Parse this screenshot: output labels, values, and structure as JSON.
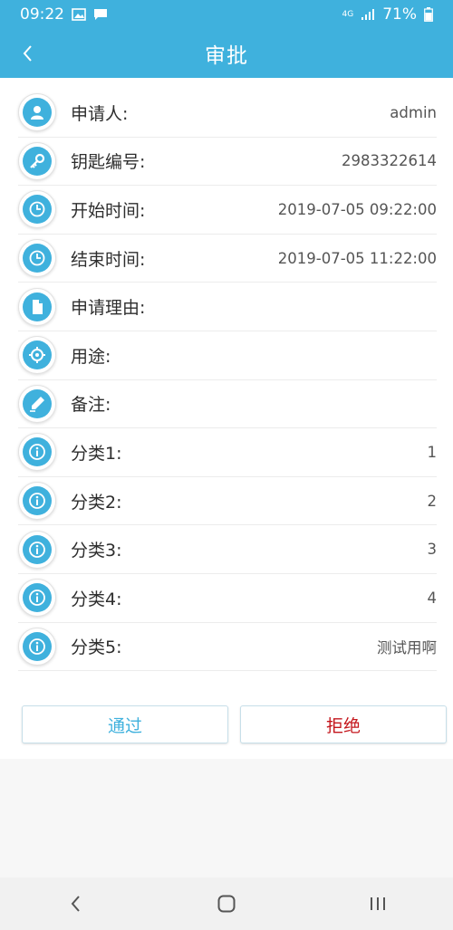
{
  "status_bar": {
    "time": "09:22",
    "network": "4G",
    "battery": "71%",
    "icons": [
      "gallery-icon",
      "message-icon",
      "signal-icon",
      "battery-icon"
    ]
  },
  "header": {
    "title": "审批",
    "back_icon": "chevron-left-icon"
  },
  "details": [
    {
      "icon": "user-icon",
      "label": "申请人:",
      "value": "admin"
    },
    {
      "icon": "key-icon",
      "label": "钥匙编号:",
      "value": "2983322614"
    },
    {
      "icon": "clock-icon",
      "label": "开始时间:",
      "value": "2019-07-05 09:22:00"
    },
    {
      "icon": "clock-icon",
      "label": "结束时间:",
      "value": "2019-07-05 11:22:00"
    },
    {
      "icon": "document-icon",
      "label": "申请理由:",
      "value": ""
    },
    {
      "icon": "target-icon",
      "label": "用途:",
      "value": ""
    },
    {
      "icon": "pen-icon",
      "label": "备注:",
      "value": ""
    },
    {
      "icon": "info-icon",
      "label": "分类1:",
      "value": "1"
    },
    {
      "icon": "info-icon",
      "label": "分类2:",
      "value": "2"
    },
    {
      "icon": "info-icon",
      "label": "分类3:",
      "value": "3"
    },
    {
      "icon": "info-icon",
      "label": "分类4:",
      "value": "4"
    },
    {
      "icon": "info-icon",
      "label": "分类5:",
      "value": "测试用啊"
    }
  ],
  "actions": {
    "approve_label": "通过",
    "reject_label": "拒绝"
  },
  "colors": {
    "primary": "#3fb1dd",
    "reject": "#c4161c"
  },
  "system_nav": {
    "back": "back-icon",
    "home": "home-icon",
    "recents": "recents-icon"
  }
}
